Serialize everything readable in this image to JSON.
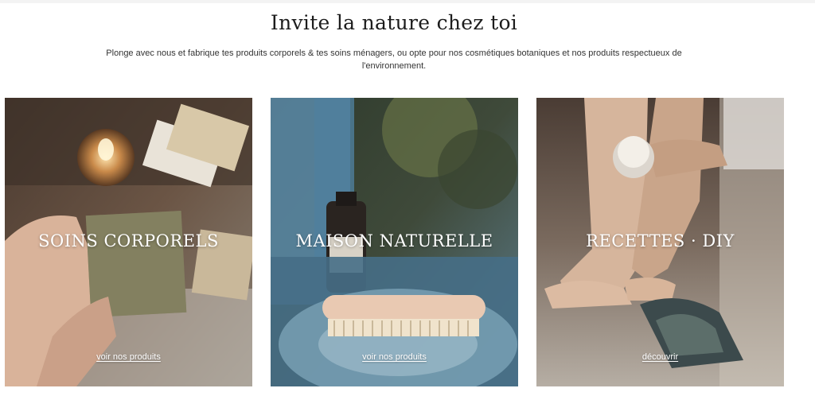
{
  "section": {
    "title": "Invite la nature chez toi",
    "subtitle": "Plonge avec nous et fabrique tes produits corporels & tes soins ménagers, ou opte pour nos cosmétiques botaniques et nos produits respectueux de l'environnement."
  },
  "cards": [
    {
      "title": "SOINS CORPORELS",
      "link": "voir nos produits"
    },
    {
      "title": "MAISON NATURELLE",
      "link": "voir nos produits"
    },
    {
      "title": "RECETTES · DIY",
      "link": "découvrir"
    }
  ],
  "colors": {
    "title_text": "#1c1c1c",
    "overlay_text": "#ffffff"
  }
}
